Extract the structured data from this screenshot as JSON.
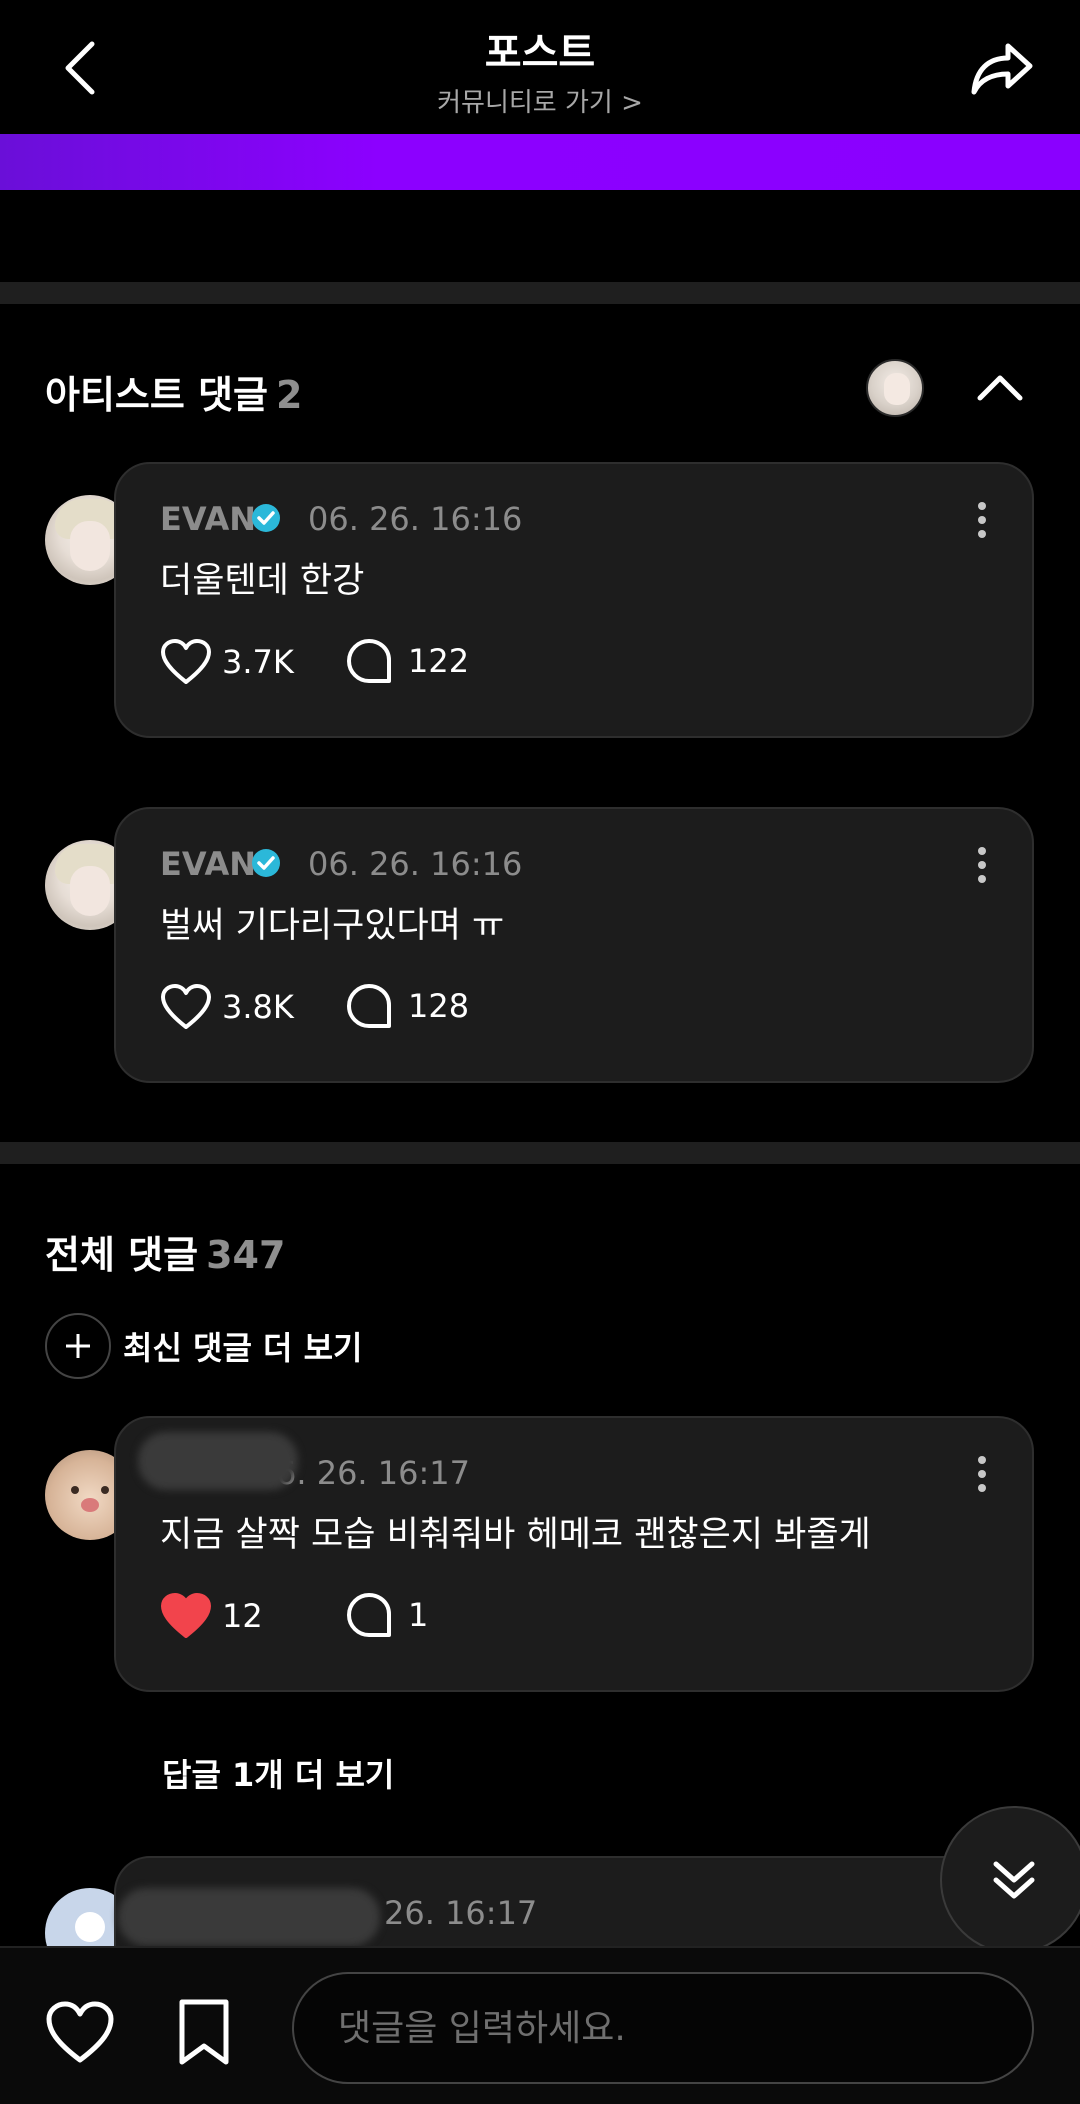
{
  "header": {
    "title": "포스트",
    "community_link": "커뮤니티로 가기 >"
  },
  "artist_section": {
    "title": "아티스트 댓글",
    "count": "2",
    "comments": [
      {
        "author": "EVAN",
        "verified": true,
        "time": "06. 26. 16:16",
        "text": "더울텐데 한강",
        "likes": "3.7K",
        "replies": "122",
        "liked": false
      },
      {
        "author": "EVAN",
        "verified": true,
        "time": "06. 26. 16:16",
        "text": "벌써 기다리구있다며 ㅠ",
        "likes": "3.8K",
        "replies": "128",
        "liked": false
      }
    ]
  },
  "all_section": {
    "title": "전체 댓글",
    "count": "347",
    "more_latest": "최신 댓글 더 보기",
    "comments": [
      {
        "author": "",
        "time": "6. 26. 16:17",
        "text": "지금 살짝 모습 비춰줘바 헤메코 괜찮은지 봐줄게",
        "likes": "12",
        "replies": "1",
        "liked": true
      },
      {
        "author": "",
        "time": "26. 16:17",
        "text": ""
      }
    ],
    "more_replies": "답글 1개 더 보기"
  },
  "bottom_bar": {
    "placeholder": "댓글을 입력하세요."
  },
  "colors": {
    "accent": "#8a00ff",
    "verified": "#2bb8d9",
    "liked": "#f2444c",
    "card_bg": "#1c1c1c"
  }
}
